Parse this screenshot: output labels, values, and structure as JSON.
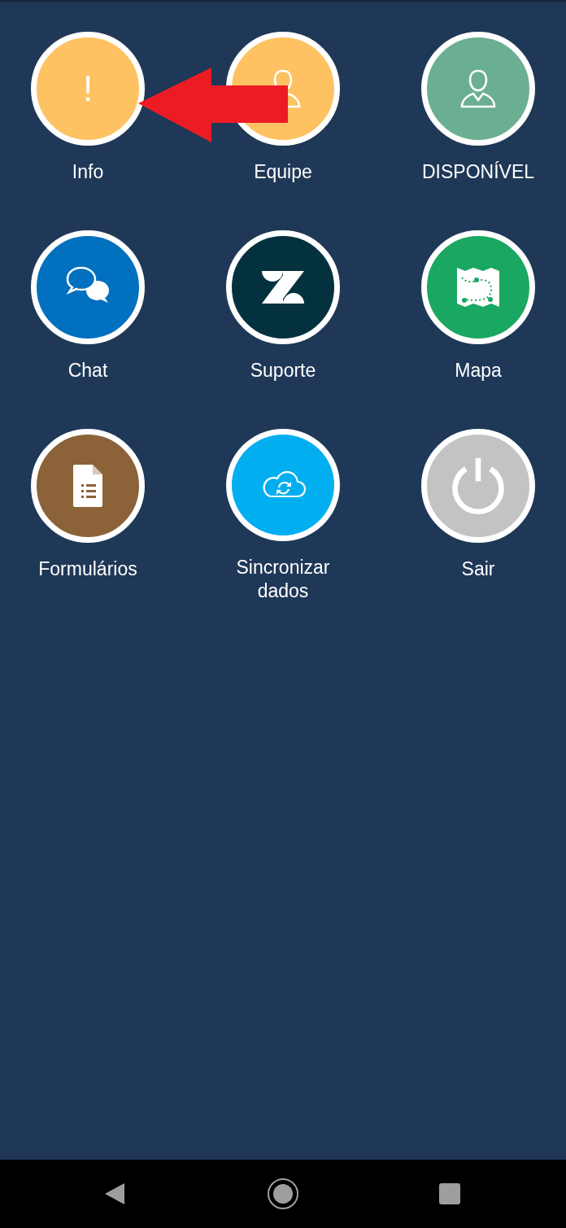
{
  "tiles": [
    {
      "label": "Info",
      "kind": "exclaim",
      "glyph": "!",
      "color": "#fec263"
    },
    {
      "label": "Equipe",
      "kind": "person",
      "color": "#fec263"
    },
    {
      "label": "DISPONÍVEL",
      "kind": "person",
      "color": "#6baf92"
    },
    {
      "label": "Chat",
      "kind": "chat",
      "color": "#0170bf"
    },
    {
      "label": "Suporte",
      "kind": "zlogo",
      "color": "#03313d"
    },
    {
      "label": "Mapa",
      "kind": "map",
      "color": "#1aa761"
    },
    {
      "label": "Formulários",
      "kind": "form",
      "color": "#8c6239"
    },
    {
      "label": "Sincronizar dados",
      "kind": "cloud",
      "color": "#01aeef"
    },
    {
      "label": "Sair",
      "kind": "power",
      "color": "#c3c3c3"
    }
  ],
  "annotation": {
    "kind": "arrow"
  }
}
